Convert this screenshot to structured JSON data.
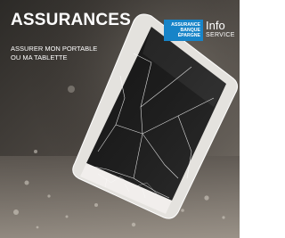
{
  "header": {
    "title": "ASSURANCES",
    "subtitle": "ASSURER MON PORTABLE OU MA TABLETTE"
  },
  "logo": {
    "line1": "ASSURANCE",
    "line2": "BANQUE",
    "line3": "ÉPARGNE",
    "info": "Info",
    "service": "SERVICE",
    "color": "#1784c8"
  },
  "photo": {
    "subject": "cracked-phone-photo"
  }
}
